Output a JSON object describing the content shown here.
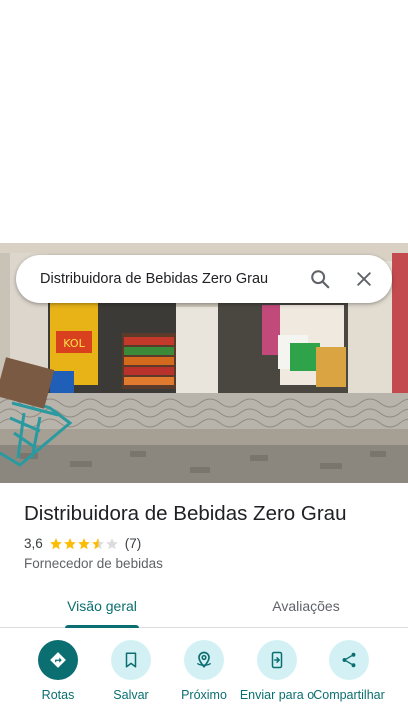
{
  "search": {
    "query": "Distribuidora de Bebidas Zero Grau",
    "search_icon": "search-icon",
    "close_icon": "close-icon"
  },
  "place": {
    "name": "Distribuidora de Bebidas Zero Grau",
    "rating": "3,6",
    "rating_value": 3.6,
    "review_count": "(7)",
    "category": "Fornecedor de bebidas"
  },
  "tabs": [
    {
      "label": "Visão geral",
      "active": true
    },
    {
      "label": "Avaliações",
      "active": false
    }
  ],
  "actions": [
    {
      "label": "Rotas",
      "icon": "directions-icon"
    },
    {
      "label": "Salvar",
      "icon": "bookmark-icon"
    },
    {
      "label": "Próximo",
      "icon": "nearby-icon"
    },
    {
      "label": "Enviar para o",
      "icon": "send-to-phone-icon"
    },
    {
      "label": "Compartilhar",
      "icon": "share-icon"
    }
  ],
  "colors": {
    "accent": "#0b6e70",
    "accent_light": "#d3f1f5",
    "star": "#fbbc04"
  }
}
